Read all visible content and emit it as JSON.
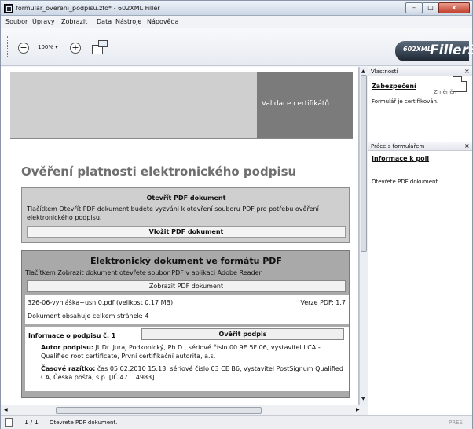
{
  "window": {
    "title": "formular_overeni_podpisu.zfo* - 602XML Filler",
    "min": "–",
    "max": "□",
    "close": "x"
  },
  "menu": [
    "Soubor",
    "Úpravy",
    "Zobrazit",
    "Data",
    "Nástroje",
    "Nápověda"
  ],
  "toolbar": {
    "zoom": "100% ▾",
    "zoom_out": "−",
    "zoom_in": "+"
  },
  "logo": {
    "small": "602XML",
    "big": "Filler3"
  },
  "doc": {
    "header_btn": "Validace certifikátů",
    "heading": "Ověření platnosti elektronického podpisu",
    "open_pdf": {
      "title": "Otevřít PDF dokument",
      "desc": "Tlačítkem Otevřít PDF dokument budete vyzváni k otevření souboru PDF pro potřebu ověření elektronického podpisu.",
      "button": "Vložit PDF dokument"
    },
    "pdf_doc": {
      "title": "Elektronický dokument ve formátu PDF",
      "desc": "Tlačítkem Zobrazit dokument otevřete soubor PDF v aplikaci Adobe Reader.",
      "button": "Zobrazit PDF dokument",
      "file": "326-06-vyhláška+usn.0.pdf (velikost 0,17 MB)",
      "version": "Verze PDF: 1.7",
      "pages": "Dokument obsahuje celkem stránek: 4"
    },
    "signature": {
      "label": "Informace o podpisu č. 1",
      "verify_button": "Ověřit podpis",
      "author_label": "Autor podpisu:",
      "author_text": " JUDr. Juraj Podkonický, Ph.D., sériové číslo 00 9E 5F 06, vystavitel I.CA - Qualified root certificate, První certifikační autorita, a.s.",
      "timestamp_label": "Časové razítko:",
      "timestamp_text": " čas 05.02.2010 15:13, sériové číslo 03 CE B6, vystavitel PostSignum Qualified CA, Česká pošta, s.p. [IČ 47114983]"
    }
  },
  "panel": {
    "props_title": "Vlastnosti",
    "security": "Zabezpečení",
    "changed": "Změněn",
    "certified": "Formulář je certifikován.",
    "work_title": "Práce s formulářem",
    "field_info": "Informace k poli",
    "field_text": "Otevřete PDF dokument."
  },
  "status": {
    "page": "1 / 1",
    "message": "Otevřete PDF dokument.",
    "mode": "PRES"
  }
}
